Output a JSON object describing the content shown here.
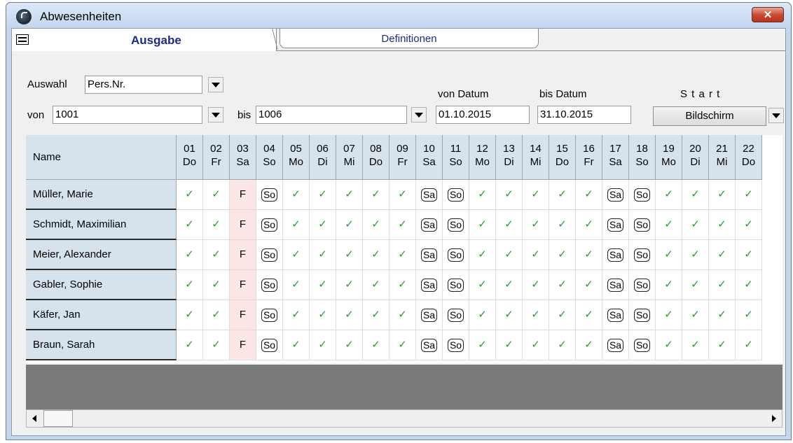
{
  "window": {
    "title": "Abwesenheiten",
    "close_label": "✕"
  },
  "tabs": {
    "active": "Ausgabe",
    "inactive": "Definitionen"
  },
  "form": {
    "auswahl_label": "Auswahl",
    "auswahl_value": "Pers.Nr.",
    "von_label": "von",
    "von_value": "1001",
    "bis_label": "bis",
    "bis_value": "1006",
    "von_datum_label": "von Datum",
    "von_datum_value": "01.10.2015",
    "bis_datum_label": "bis Datum",
    "bis_datum_value": "31.10.2015",
    "start_label": "S t a r t",
    "start_button": "Bildschirm"
  },
  "grid": {
    "name_header": "Name",
    "days": [
      {
        "num": "01",
        "wd": "Do"
      },
      {
        "num": "02",
        "wd": "Fr"
      },
      {
        "num": "03",
        "wd": "Sa"
      },
      {
        "num": "04",
        "wd": "So"
      },
      {
        "num": "05",
        "wd": "Mo"
      },
      {
        "num": "06",
        "wd": "Di"
      },
      {
        "num": "07",
        "wd": "Mi"
      },
      {
        "num": "08",
        "wd": "Do"
      },
      {
        "num": "09",
        "wd": "Fr"
      },
      {
        "num": "10",
        "wd": "Sa"
      },
      {
        "num": "11",
        "wd": "So"
      },
      {
        "num": "12",
        "wd": "Mo"
      },
      {
        "num": "13",
        "wd": "Di"
      },
      {
        "num": "14",
        "wd": "Mi"
      },
      {
        "num": "15",
        "wd": "Do"
      },
      {
        "num": "16",
        "wd": "Fr"
      },
      {
        "num": "17",
        "wd": "Sa"
      },
      {
        "num": "18",
        "wd": "So"
      },
      {
        "num": "19",
        "wd": "Mo"
      },
      {
        "num": "20",
        "wd": "Di"
      },
      {
        "num": "21",
        "wd": "Mi"
      },
      {
        "num": "22",
        "wd": "Do"
      }
    ],
    "cell_pattern": [
      "✓",
      "✓",
      "F",
      "So",
      "✓",
      "✓",
      "✓",
      "✓",
      "✓",
      "Sa",
      "So",
      "✓",
      "✓",
      "✓",
      "✓",
      "✓",
      "Sa",
      "So",
      "✓",
      "✓",
      "✓",
      "✓"
    ],
    "rows": [
      {
        "name": "Müller, Marie"
      },
      {
        "name": "Schmidt, Maximilian"
      },
      {
        "name": "Meier, Alexander"
      },
      {
        "name": "Gabler, Sophie"
      },
      {
        "name": "Käfer, Jan"
      },
      {
        "name": "Braun, Sarah"
      }
    ]
  },
  "colors": {
    "header_bg": "#d6e2ec",
    "holiday_bg": "#fde6e6",
    "check": "#2e9a2e",
    "tab_text": "#1c2a86"
  }
}
